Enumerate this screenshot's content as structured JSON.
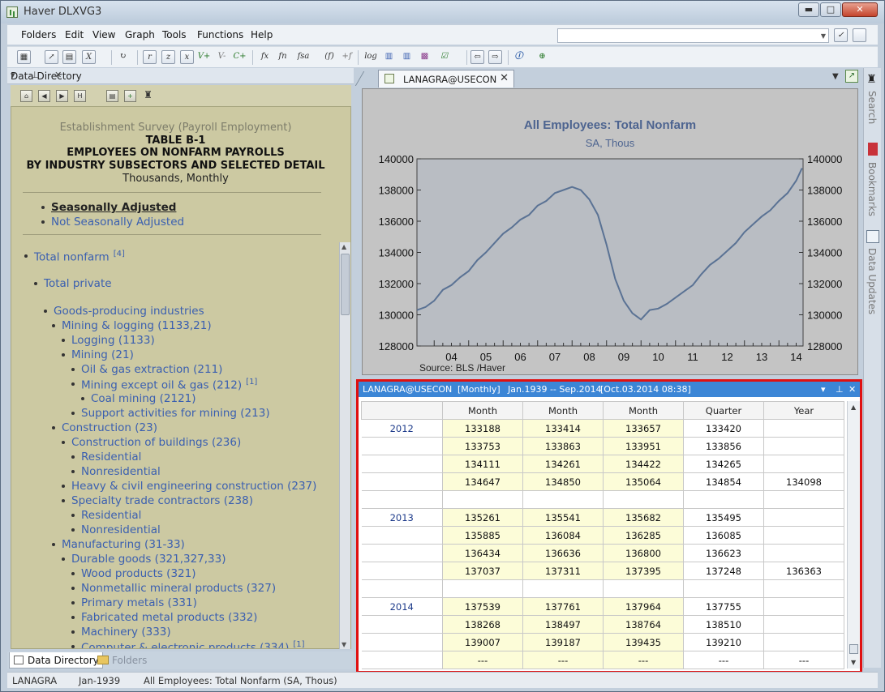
{
  "window": {
    "title": "Haver DLXVG3"
  },
  "menubar": {
    "items": [
      "Folders",
      "Edit",
      "View",
      "Graph",
      "Tools",
      "Functions",
      "Help"
    ]
  },
  "toolbar": {
    "left_glyphs": [
      "r",
      "z",
      "x",
      "V+",
      "V-",
      "C+",
      "fx",
      "fn",
      "fsa",
      "(f)",
      "+f",
      "log"
    ]
  },
  "left_panel": {
    "header": "Data Directory",
    "directory": {
      "subtitle": "Establishment Survey (Payroll Employment)",
      "table_id": "TABLE B-1",
      "title_line1": "EMPLOYEES ON NONFARM PAYROLLS",
      "title_line2": "BY INDUSTRY SUBSECTORS AND SELECTED DETAIL",
      "units": "Thousands, Monthly",
      "options": [
        {
          "label": "Seasonally Adjusted",
          "selected": true
        },
        {
          "label": "Not Seasonally Adjusted",
          "selected": false
        }
      ],
      "tree": [
        {
          "label": "Total nonfarm",
          "note": "[4]",
          "level": 0
        },
        {
          "label": "Total private",
          "note": "",
          "level": 1
        },
        {
          "label": "Goods-producing industries",
          "note": "",
          "level": 2
        },
        {
          "label": "Mining & logging (1133,21)",
          "note": "",
          "level": 3
        },
        {
          "label": "Logging (1133)",
          "note": "",
          "level": 4
        },
        {
          "label": "Mining (21)",
          "note": "",
          "level": 4
        },
        {
          "label": "Oil & gas extraction (211)",
          "note": "",
          "level": 5
        },
        {
          "label": "Mining except oil & gas (212)",
          "note": "[1]",
          "level": 5
        },
        {
          "label": "Coal mining (2121)",
          "note": "",
          "level": 6
        },
        {
          "label": "Support activities for mining (213)",
          "note": "",
          "level": 5
        },
        {
          "label": "Construction (23)",
          "note": "",
          "level": 3
        },
        {
          "label": "Construction of buildings (236)",
          "note": "",
          "level": 4
        },
        {
          "label": "Residential",
          "note": "",
          "level": 5
        },
        {
          "label": "Nonresidential",
          "note": "",
          "level": 5
        },
        {
          "label": "Heavy & civil engineering construction (237)",
          "note": "",
          "level": 4
        },
        {
          "label": "Specialty trade contractors (238)",
          "note": "",
          "level": 4
        },
        {
          "label": "Residential",
          "note": "",
          "level": 5
        },
        {
          "label": "Nonresidential",
          "note": "",
          "level": 5
        },
        {
          "label": "Manufacturing (31-33)",
          "note": "",
          "level": 3
        },
        {
          "label": "Durable goods (321,327,33)",
          "note": "",
          "level": 4
        },
        {
          "label": "Wood products (321)",
          "note": "",
          "level": 5
        },
        {
          "label": "Nonmetallic mineral products (327)",
          "note": "",
          "level": 5
        },
        {
          "label": "Primary metals (331)",
          "note": "",
          "level": 5
        },
        {
          "label": "Fabricated metal products (332)",
          "note": "",
          "level": 5
        },
        {
          "label": "Machinery (333)",
          "note": "",
          "level": 5
        },
        {
          "label": "Computer & electronic products (334)",
          "note": "[1]",
          "level": 5
        }
      ]
    },
    "tabs": [
      "Data Directory",
      "Folders"
    ]
  },
  "document": {
    "tab_label": "LANAGRA@USECON"
  },
  "chart_data": {
    "type": "line",
    "title": "All Employees: Total Nonfarm",
    "subtitle": "SA, Thous",
    "source": "Source:  BLS /Haver",
    "xlabel": "",
    "ylabel": "",
    "x_ticks": [
      "04",
      "05",
      "06",
      "07",
      "08",
      "09",
      "10",
      "11",
      "12",
      "13",
      "14"
    ],
    "y_ticks": [
      "128000",
      "130000",
      "132000",
      "134000",
      "136000",
      "138000",
      "140000"
    ],
    "ylim": [
      128000,
      140000
    ],
    "xlim": [
      2003.5,
      2014.7
    ],
    "grid": false,
    "series": [
      {
        "color": "#5a7294",
        "x": [
          2003.5,
          2003.75,
          2004.0,
          2004.25,
          2004.5,
          2004.75,
          2005.0,
          2005.25,
          2005.5,
          2005.75,
          2006.0,
          2006.25,
          2006.5,
          2006.75,
          2007.0,
          2007.25,
          2007.5,
          2007.75,
          2008.0,
          2008.25,
          2008.5,
          2008.75,
          2009.0,
          2009.25,
          2009.5,
          2009.75,
          2010.0,
          2010.25,
          2010.5,
          2010.75,
          2011.0,
          2011.25,
          2011.5,
          2011.75,
          2012.0,
          2012.25,
          2012.5,
          2012.75,
          2013.0,
          2013.25,
          2013.5,
          2013.75,
          2014.0,
          2014.25,
          2014.5,
          2014.67
        ],
        "values": [
          130300,
          130500,
          130900,
          131600,
          131900,
          132400,
          132800,
          133500,
          134000,
          134600,
          135200,
          135600,
          136100,
          136400,
          137000,
          137300,
          137800,
          138000,
          138200,
          138000,
          137400,
          136400,
          134500,
          132300,
          130900,
          130100,
          129700,
          130300,
          130400,
          130700,
          131100,
          131500,
          131900,
          132600,
          133200,
          133600,
          134100,
          134600,
          135300,
          135800,
          136300,
          136700,
          137300,
          137800,
          138600,
          139400
        ]
      }
    ]
  },
  "grid": {
    "title_series": "LANAGRA@USECON",
    "title_freq": "[Monthly]",
    "title_range": "Jan.1939 -- Sep.2014",
    "title_updated": "[Oct.03.2014 08:38]",
    "columns": [
      "",
      "Month",
      "Month",
      "Month",
      "Quarter",
      "Year"
    ],
    "rows": [
      [
        "2012",
        "133188",
        "133414",
        "133657",
        "133420",
        ""
      ],
      [
        "",
        "133753",
        "133863",
        "133951",
        "133856",
        ""
      ],
      [
        "",
        "134111",
        "134261",
        "134422",
        "134265",
        ""
      ],
      [
        "",
        "134647",
        "134850",
        "135064",
        "134854",
        "134098"
      ],
      [
        "",
        "",
        "",
        "",
        "",
        ""
      ],
      [
        "2013",
        "135261",
        "135541",
        "135682",
        "135495",
        ""
      ],
      [
        "",
        "135885",
        "136084",
        "136285",
        "136085",
        ""
      ],
      [
        "",
        "136434",
        "136636",
        "136800",
        "136623",
        ""
      ],
      [
        "",
        "137037",
        "137311",
        "137395",
        "137248",
        "136363"
      ],
      [
        "",
        "",
        "",
        "",
        "",
        ""
      ],
      [
        "2014",
        "137539",
        "137761",
        "137964",
        "137755",
        ""
      ],
      [
        "",
        "138268",
        "138497",
        "138764",
        "138510",
        ""
      ],
      [
        "",
        "139007",
        "139187",
        "139435",
        "139210",
        ""
      ],
      [
        "",
        "---",
        "---",
        "---",
        "---",
        "---"
      ]
    ]
  },
  "right_sidebar": {
    "tabs": [
      "Search",
      "Bookmarks",
      "Data Updates"
    ]
  },
  "statusbar": {
    "series": "LANAGRA",
    "start": "Jan-1939",
    "description": "All Employees: Total Nonfarm (SA, Thous)"
  },
  "colors": {
    "accent": "#3c86d6",
    "highlight_border": "#e01010",
    "directory_bg": "#ccc9a2",
    "month_cell": "#fcfcd8"
  }
}
